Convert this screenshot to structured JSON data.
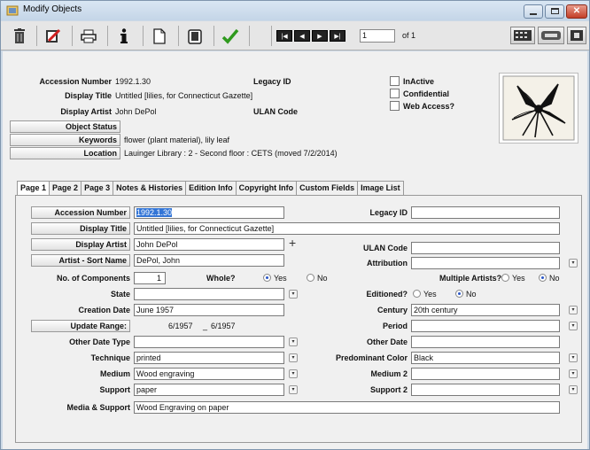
{
  "window": {
    "title": "Modify Objects"
  },
  "toolbar": {
    "record_number": "1",
    "record_of": "of 1",
    "nav": [
      "|◀",
      "◀",
      "▶",
      "▶|"
    ]
  },
  "header": {
    "accession_number_label": "Accession Number",
    "accession_number": "1992.1.30",
    "legacy_id_label": "Legacy ID",
    "display_title_label": "Display Title",
    "display_title": "Untitled [lilies, for Connecticut Gazette]",
    "display_artist_label": "Display Artist",
    "display_artist": "John DePol",
    "ulan_code_label": "ULAN Code",
    "object_status_label": "Object Status",
    "keywords_label": "Keywords",
    "keywords": "flower (plant material), lily leaf",
    "location_label": "Location",
    "location": "Lauinger Library : 2 - Second floor : CETS (moved 7/2/2014)",
    "checkboxes": [
      "InActive",
      "Confidential",
      "Web Access?"
    ]
  },
  "tabs": [
    "Page 1",
    "Page 2",
    "Page 3",
    "Notes & Histories",
    "Edition Info",
    "Copyright Info",
    "Custom Fields",
    "Image List"
  ],
  "form": {
    "accession_number_label": "Accession Number",
    "accession_number": "1992.1.30",
    "legacy_id_label": "Legacy ID",
    "display_title_label": "Display Title",
    "display_title": "Untitled [lilies, for Connecticut Gazette]",
    "display_artist_label": "Display Artist",
    "display_artist": "John DePol",
    "ulan_code_label": "ULAN Code",
    "artist_sort_label": "Artist - Sort Name",
    "artist_sort": "DePol, John",
    "attribution_label": "Attribution",
    "components_label": "No. of Components",
    "components": "1",
    "whole_label": "Whole?",
    "yes": "Yes",
    "no": "No",
    "multiple_artists_label": "Multiple Artists?",
    "state_label": "State",
    "editioned_label": "Editioned?",
    "creation_date_label": "Creation Date",
    "creation_date": "June 1957",
    "century_label": "Century",
    "century": "20th century",
    "update_range_label": "Update Range:",
    "range_from": "6/1957",
    "range_sep": "_",
    "range_to": "6/1957",
    "period_label": "Period",
    "other_date_type_label": "Other Date Type",
    "other_date_label": "Other Date",
    "technique_label": "Technique",
    "technique": "printed",
    "predominant_color_label": "Predominant Color",
    "predominant_color": "Black",
    "medium_label": "Medium",
    "medium": "Wood engraving",
    "medium2_label": "Medium 2",
    "support_label": "Support",
    "support": "paper",
    "support2_label": "Support 2",
    "media_support_label": "Media & Support",
    "media_support": "Wood Engraving on paper"
  },
  "icons": [
    "delete-icon",
    "cancel-edit-icon",
    "print-icon",
    "info-icon",
    "new-document-icon",
    "copy-icon",
    "save-check-icon"
  ]
}
